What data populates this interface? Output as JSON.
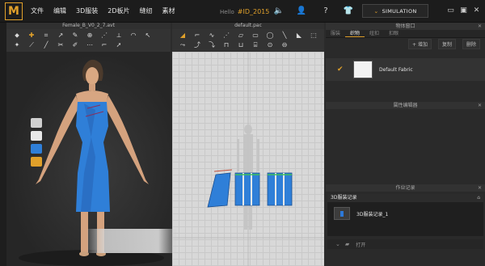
{
  "app": {
    "logo": "M",
    "menu": [
      "文件",
      "编辑",
      "3D服装",
      "2D板片",
      "缝纫",
      "素材"
    ],
    "user_prefix": "Hello",
    "user_id": "#ID_2015",
    "simulation_label": "SIMULATION"
  },
  "panel3d": {
    "title": "Female_B_V0_2_7.avt"
  },
  "panel2d": {
    "title": "default.pac"
  },
  "right": {
    "object_window_title": "物体窗口",
    "tabs": [
      "服装",
      "织物",
      "纽扣",
      "扣眼"
    ],
    "active_tab": "织物",
    "add_label": "+ 增加",
    "copy_label": "复制",
    "delete_label": "删除",
    "fabric_name": "Default Fabric",
    "property_editor_title": "属性编辑器",
    "history_title": "作业记录",
    "history_header": "3D服装记录",
    "history_item": "3D服装记录_1",
    "open_label": "打开"
  },
  "colors": {
    "accent": "#e0a02a",
    "dress": "#2f7fd8"
  }
}
